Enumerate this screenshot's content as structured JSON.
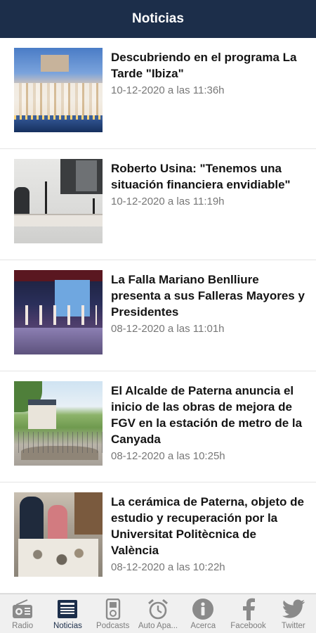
{
  "header": {
    "title": "Noticias"
  },
  "news": [
    {
      "title": "Descubriendo en el programa La Tarde \"Ibiza\"",
      "date": "10-12-2020 a las 11:36h"
    },
    {
      "title": "Roberto Usina: \"Tenemos una situación financiera envidiable\"",
      "date": "10-12-2020 a las 11:19h"
    },
    {
      "title": "La Falla Mariano Benlliure presenta a sus Falleras Mayores y Presidentes",
      "date": "08-12-2020 a las 11:01h"
    },
    {
      "title": "El Alcalde de Paterna anuncia el inicio de las obras de mejora de FGV en la estación de metro de la Canyada",
      "date": "08-12-2020 a las 10:25h"
    },
    {
      "title": "La cerámica de Paterna, objeto de estudio y recuperación por la Universitat Politècnica de València",
      "date": "08-12-2020 a las 10:22h"
    }
  ],
  "tabbar": {
    "items": [
      {
        "label": "Radio",
        "icon": "radio-icon"
      },
      {
        "label": "Noticias",
        "icon": "newspaper-icon",
        "active": true
      },
      {
        "label": "Podcasts",
        "icon": "podcast-device-icon"
      },
      {
        "label": "Auto Apa...",
        "icon": "alarm-clock-icon"
      },
      {
        "label": "Acerca",
        "icon": "info-icon"
      },
      {
        "label": "Facebook",
        "icon": "facebook-icon"
      },
      {
        "label": "Twitter",
        "icon": "twitter-icon"
      }
    ]
  },
  "colors": {
    "header_bg": "#1c2e4a",
    "active_tab": "#1c2e4a",
    "inactive_tab": "#8a8a8a"
  }
}
